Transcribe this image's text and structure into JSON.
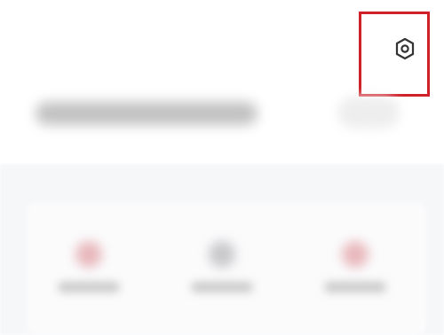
{
  "header": {
    "settings_icon": "settings-hexagon-icon",
    "title_text": "",
    "side_button_text": ""
  },
  "shortcuts": [
    {
      "icon": "shortcut-1-icon",
      "label": "",
      "color": "#e8b9bd"
    },
    {
      "icon": "shortcut-2-icon",
      "label": "",
      "color": "#c9c9cc"
    },
    {
      "icon": "shortcut-3-icon",
      "label": "",
      "color": "#e8b9bd"
    }
  ],
  "colors": {
    "highlight": "#d0202a",
    "icon": "#333333",
    "background": "#ffffff",
    "panel": "#f6f7f9"
  }
}
